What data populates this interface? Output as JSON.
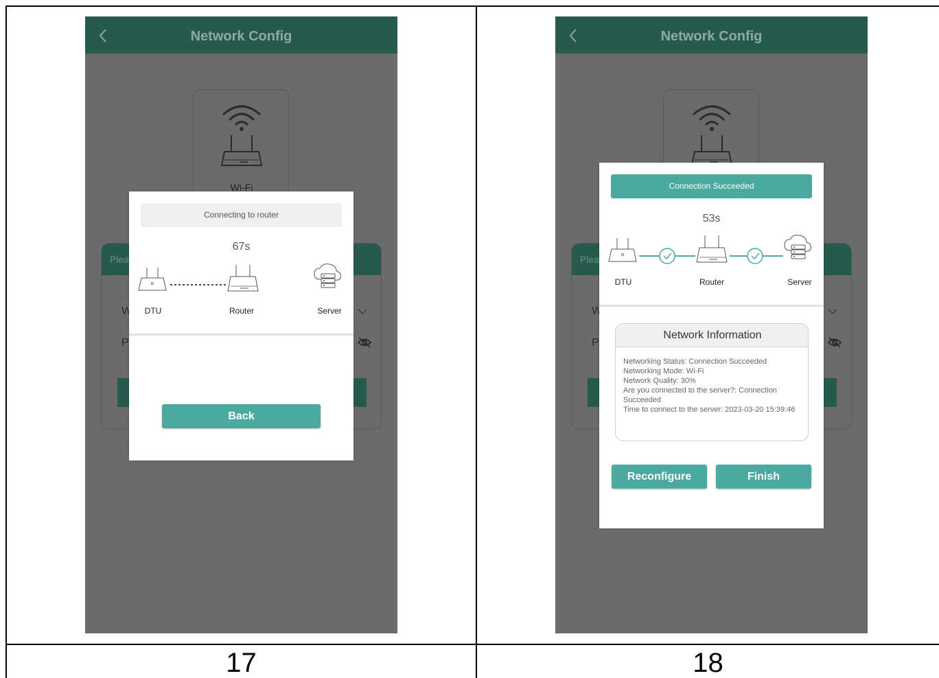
{
  "document": {
    "cells": [
      {
        "number": "17"
      },
      {
        "number": "18"
      }
    ]
  },
  "panels": [
    {
      "app": {
        "title": "Network Config",
        "wifi_card_label": "Wi-Fi",
        "form_card_header": "Plea",
        "form_row1_letter": "W",
        "form_row2_letter": "P"
      },
      "dialog": {
        "status": "Connecting to router",
        "timer": "67s",
        "nodes": {
          "dtu": "DTU",
          "router": "Router",
          "server": "Server"
        },
        "back_label": "Back"
      }
    },
    {
      "app": {
        "title": "Network Config",
        "wifi_card_label": "",
        "form_card_header": "Plea",
        "form_row1_letter": "W",
        "form_row2_letter": "P"
      },
      "dialog": {
        "status": "Connection Succeeded",
        "timer": "53s",
        "nodes": {
          "dtu": "DTU",
          "router": "Router",
          "server": "Server"
        },
        "info_title": "Network Information",
        "info_lines": {
          "status": "Networking Status: Connection Succeeded",
          "mode": "Networking Mode: Wi-Fi",
          "quality": "Network Quality: 30%",
          "server_connected": "Are you connected to the server?: Connection Succeeded",
          "connect_time": "Time to connect to the server: 2023-03-20 15:39:46"
        },
        "reconfigure_label": "Reconfigure",
        "finish_label": "Finish"
      }
    }
  ],
  "colors": {
    "header_dim": "#265a4f",
    "overlay_bg": "#6b6b6b",
    "accent_teal": "#4aaa9f",
    "pill_grey": "#efefef"
  },
  "icons": [
    "chevron-left-icon",
    "wifi-router-icon",
    "dtu-icon",
    "router-icon",
    "cloud-server-icon",
    "check-circle-icon",
    "chevron-down-icon",
    "eye-hidden-icon"
  ]
}
